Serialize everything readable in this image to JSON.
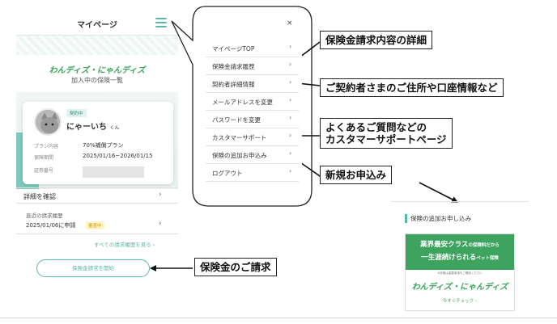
{
  "phone": {
    "title": "マイページ",
    "logo": "わんディズ・にゃんディズ",
    "plan_list_title": "加入中の保険一覧",
    "card": {
      "badge": "契約中",
      "pet_name": "にゃーいち",
      "pet_honorific": "くん",
      "rows": [
        {
          "label": "プラン内容",
          "value": "70%補償プラン"
        },
        {
          "label": "保険期間",
          "value": "2025/01/16~2026/01/15"
        },
        {
          "label": "証券番号",
          "value": ""
        }
      ]
    },
    "details_label": "詳細を確認",
    "recent_label": "直近の請求履歴",
    "recent_date": "2025/01/06に申請",
    "recent_status": "審査中",
    "all_history": "すべての請求履歴を見る",
    "claim_button": "保険金請求を開始",
    "chevron": "›"
  },
  "menu": {
    "close": "×",
    "items": [
      {
        "label": "マイページTOP"
      },
      {
        "label": "保険金請求履歴"
      },
      {
        "label": "契約者詳細情報"
      },
      {
        "label": "メールアドレスを変更"
      },
      {
        "label": "パスワードを変更"
      },
      {
        "label": "カスタマーサポート"
      },
      {
        "label": "保険の追加お申込み"
      },
      {
        "label": "ログアウト"
      }
    ],
    "chevron": "›"
  },
  "notes": {
    "claim_detail": "保険金請求内容の詳細",
    "contractor": "ご契約者さまのご住所や口座情報など",
    "support_line1": "よくあるご質問などの",
    "support_line2": "カスタマーサポートページ",
    "new_application": "新規お申込み",
    "claim": "保険金のご請求"
  },
  "right_panel": {
    "title": "保険の追加お申し込み",
    "ad_line1": "業界最安クラス",
    "ad_line1_small": "の保険料だから",
    "ad_line2": "一生涯続けられる",
    "ad_line2_small": "ペット保険",
    "ad_note": "※詳細は重要事項をご確認ください",
    "ad_logo": "わんディズ・にゃんディズ",
    "ad_cta": "今すぐチェック ›"
  },
  "colors": {
    "accent": "#5bb7a7",
    "brand_green": "#3ea35f",
    "status_pending": "#d99a00"
  }
}
